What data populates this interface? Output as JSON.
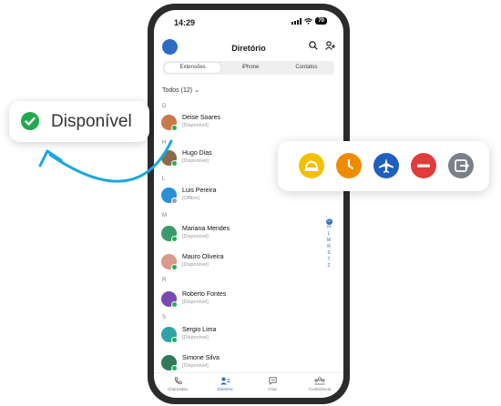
{
  "statusbar": {
    "time": "14:29",
    "battery": "70"
  },
  "appbar": {
    "title": "Diretório"
  },
  "segments": [
    "Extensões",
    "iPhone",
    "Contatos"
  ],
  "filter": "Todos (12)",
  "sections": [
    {
      "letter": "D",
      "contacts": [
        {
          "name": "Deise Soares",
          "status": "[Disponível]"
        }
      ]
    },
    {
      "letter": "H",
      "contacts": [
        {
          "name": "Hugo Dias",
          "status": "[Disponível]"
        }
      ]
    },
    {
      "letter": "L",
      "contacts": [
        {
          "name": "Luis Pereira",
          "status": "[Offline]"
        }
      ]
    },
    {
      "letter": "M",
      "contacts": [
        {
          "name": "Mariana Mendes",
          "status": "[Disponível]"
        },
        {
          "name": "Mauro Oliveira",
          "status": "[Disponível]"
        }
      ]
    },
    {
      "letter": "R",
      "contacts": [
        {
          "name": "Roberto Fontes",
          "status": "[Disponível]"
        }
      ]
    },
    {
      "letter": "S",
      "contacts": [
        {
          "name": "Sergio Lima",
          "status": "[Disponível]"
        },
        {
          "name": "Simone Silva",
          "status": "[Disponível]"
        }
      ]
    }
  ],
  "index": [
    "D",
    "H",
    "L",
    "M",
    "R",
    "S",
    "T",
    "Z"
  ],
  "tabs": [
    "Chamadas",
    "Diretório",
    "Chat",
    "Conferência"
  ],
  "callout": {
    "label": "Disponível"
  },
  "status_colors": {
    "available": "#22a94f",
    "offline": "#a0a0a0",
    "accent": "#2b6cc4"
  },
  "status_options": [
    {
      "icon": "service-bell-icon",
      "color": "#f2c200"
    },
    {
      "icon": "clock-icon",
      "color": "#f08a00"
    },
    {
      "icon": "airplane-icon",
      "color": "#1f5fbf"
    },
    {
      "icon": "do-not-disturb-icon",
      "color": "#e23b3b"
    },
    {
      "icon": "logout-icon",
      "color": "#7a7f89"
    }
  ]
}
